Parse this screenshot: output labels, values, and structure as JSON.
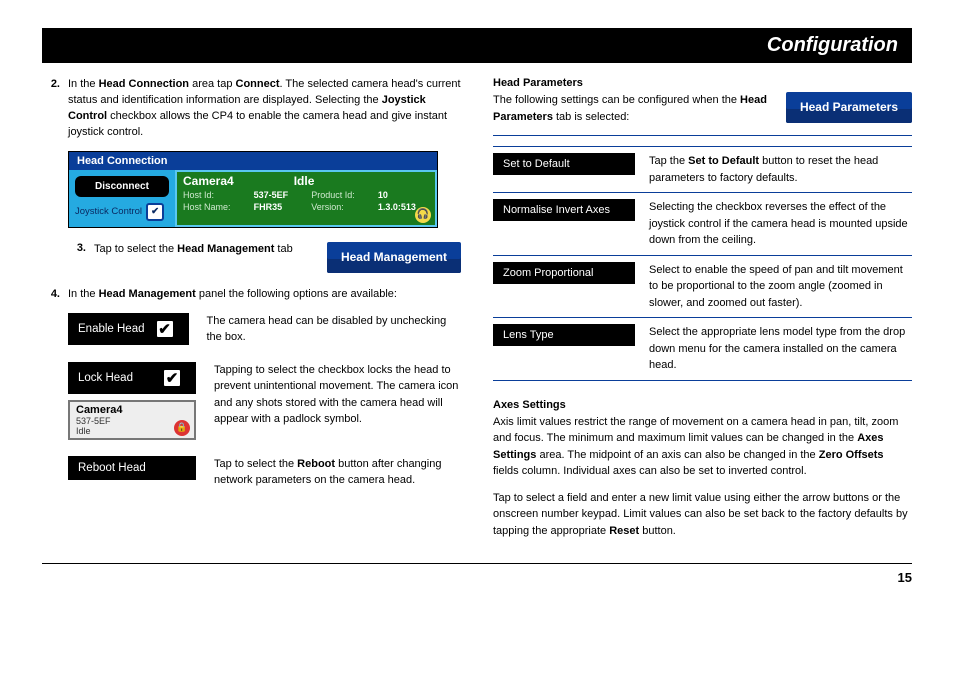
{
  "title": "Configuration",
  "page_number": "15",
  "left": {
    "step2_num": "2.",
    "step2_a": "In the ",
    "step2_b": "Head Connection",
    "step2_c": " area tap ",
    "step2_d": "Connect",
    "step2_e": ". The selected camera head's current status and identification information are displayed. Selecting the ",
    "step2_f": "Joystick Control",
    "step2_g": " checkbox allows the CP4 to enable the camera head and give instant joystick control.",
    "hc": {
      "header": "Head Connection",
      "disconnect": "Disconnect",
      "joystick": "Joystick Control",
      "check": "✔",
      "cam_name": "Camera4",
      "cam_state": "Idle",
      "hostid_l": "Host Id:",
      "hostid_v": "537-5EF",
      "prodid_l": "Product Id:",
      "prodid_v": "10",
      "hostn_l": "Host Name:",
      "hostn_v": "FHR35",
      "ver_l": "Version:",
      "ver_v": "1.3.0:513",
      "hp_glyph": "🎧"
    },
    "step3_num": "3.",
    "step3_a": "Tap to select the ",
    "step3_b": "Head Management",
    "step3_c": " tab",
    "tab_hm": "Head Management",
    "step4_num": "4.",
    "step4_a": "In the ",
    "step4_b": "Head Management",
    "step4_c": " panel the following options are available:",
    "opts": {
      "enable": "Enable Head",
      "enable_desc": "The camera head can be disabled by unchecking the box.",
      "lock": "Lock Head",
      "lock_desc": "Tapping to select the checkbox locks the head to prevent unintentional movement. The camera icon and any shots stored with the camera head will appear with a padlock symbol.",
      "card_name": "Camera4",
      "card_id": "537-5EF",
      "card_state": "Idle",
      "lock_glyph": "🔒",
      "reboot": "Reboot Head",
      "reboot_desc_a": "Tap to select the ",
      "reboot_desc_b": "Reboot",
      "reboot_desc_c": " button after changing network parameters on the camera head."
    }
  },
  "right": {
    "hp_heading": "Head Parameters",
    "hp_intro_a": "The following settings can be configured when the ",
    "hp_intro_b": "Head Parameters",
    "hp_intro_c": " tab is selected:",
    "tab_hp": "Head Parameters",
    "rows": [
      {
        "label": "Set to Default",
        "txt_a": "Tap the ",
        "txt_b": "Set to Default",
        "txt_c": " button to reset the head parameters to factory defaults."
      },
      {
        "label": "Normalise Invert Axes",
        "txt": "Selecting the checkbox reverses the effect of the joystick control if the camera head is mounted upside down from the ceiling."
      },
      {
        "label": "Zoom Proportional",
        "txt": "Select to enable the speed of pan and tilt movement to be proportional to the zoom angle (zoomed in slower, and zoomed out faster)."
      },
      {
        "label": "Lens Type",
        "txt": "Select the appropriate lens model type from the drop down menu for the camera installed on the camera head."
      }
    ],
    "axes_heading": "Axes Settings",
    "axes_p1_a": "Axis limit values restrict the range of movement on a camera head in pan, tilt, zoom and focus. The minimum and maximum limit values can be changed in the ",
    "axes_p1_b": "Axes Settings",
    "axes_p1_c": " area. The midpoint of an axis can also be changed in the ",
    "axes_p1_d": "Zero Offsets",
    "axes_p1_e": " fields column. Individual axes can also be set to inverted control.",
    "axes_p2_a": "Tap to select a field and enter a new limit value using either the arrow buttons or the onscreen number keypad. Limit values can also be set back to the factory defaults by tapping the appropriate ",
    "axes_p2_b": "Reset",
    "axes_p2_c": " button."
  }
}
